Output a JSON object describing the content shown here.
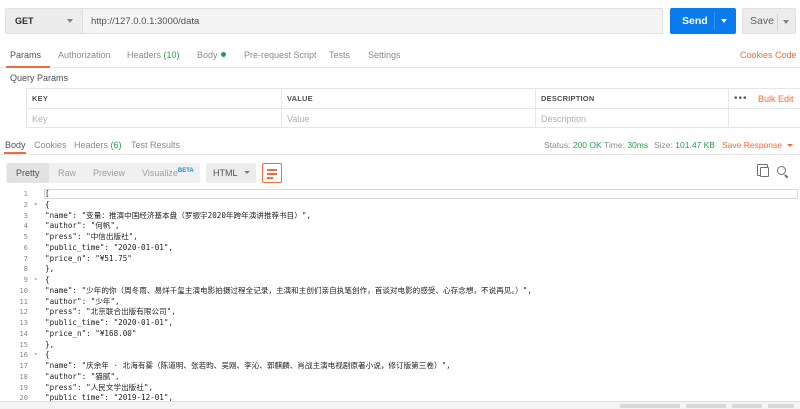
{
  "request": {
    "method": "GET",
    "url": "http://127.0.0.1:3000/data",
    "send_label": "Send",
    "save_label": "Save"
  },
  "request_tabs": [
    {
      "label": "Params",
      "active": true
    },
    {
      "label": "Authorization"
    },
    {
      "label": "Headers",
      "count": "(10)"
    },
    {
      "label": "Body",
      "dot": true
    },
    {
      "label": "Pre-request Script"
    },
    {
      "label": "Tests"
    },
    {
      "label": "Settings"
    }
  ],
  "links": {
    "cookies": "Cookies",
    "code": "Code",
    "bulk_edit": "Bulk Edit",
    "more": "•••"
  },
  "query_params": {
    "title": "Query Params",
    "headers": [
      "KEY",
      "VALUE",
      "DESCRIPTION"
    ],
    "placeholders": [
      "Key",
      "Value",
      "Description"
    ]
  },
  "response_tabs": [
    {
      "label": "Body",
      "active": true
    },
    {
      "label": "Cookies"
    },
    {
      "label": "Headers",
      "count": "(6)"
    },
    {
      "label": "Test Results"
    }
  ],
  "response_status": {
    "status_label": "Status:",
    "status_value": "200 OK",
    "time_label": "Time:",
    "time_value": "30ms",
    "size_label": "Size:",
    "size_value": "101.47 KB",
    "save_response": "Save Response"
  },
  "format_buttons": {
    "pretty": "Pretty",
    "raw": "Raw",
    "preview": "Preview",
    "visualize": "Visualize",
    "beta": "BETA"
  },
  "language": "HTML",
  "code_lines": [
    {
      "n": "1",
      "fold": "",
      "text": "["
    },
    {
      "n": "2",
      "fold": "▾",
      "text": "{"
    },
    {
      "n": "3",
      "fold": "",
      "text": "\"name\": \"变量：推演中国经济基本盘（罗振宇2020年跨年演讲推荐书目）\","
    },
    {
      "n": "4",
      "fold": "",
      "text": "\"author\": \"何帆\","
    },
    {
      "n": "5",
      "fold": "",
      "text": "\"press\": \"中信出版社\","
    },
    {
      "n": "6",
      "fold": "",
      "text": "\"public_time\": \"2020-01-01\","
    },
    {
      "n": "7",
      "fold": "",
      "text": "\"price_n\": \"¥51.75\""
    },
    {
      "n": "8",
      "fold": "",
      "text": "},"
    },
    {
      "n": "9",
      "fold": "▾",
      "text": "{"
    },
    {
      "n": "10",
      "fold": "",
      "text": "\"name\": \"少年的你（周冬雨、易烊千玺主演电影拍摄过程全记录，主演和主创们亲自执笔创作，首谈对电影的感受、心存念想，不说再见。）\","
    },
    {
      "n": "11",
      "fold": "",
      "text": "\"author\": \"少年\","
    },
    {
      "n": "12",
      "fold": "",
      "text": "\"press\": \"北京联合出版有限公司\","
    },
    {
      "n": "13",
      "fold": "",
      "text": "\"public_time\": \"2020-01-01\","
    },
    {
      "n": "14",
      "fold": "",
      "text": "\"price_n\": \"¥168.00\""
    },
    {
      "n": "15",
      "fold": "",
      "text": "},"
    },
    {
      "n": "16",
      "fold": "▾",
      "text": "{"
    },
    {
      "n": "17",
      "fold": "",
      "text": "\"name\": \"庆余年 · 北海有雾（陈道明、张若昀、吴刚、李沁、郭麒麟、肖战主演电视剧原著小说，修订版第三卷）\","
    },
    {
      "n": "18",
      "fold": "",
      "text": "\"author\": \"猫腻\","
    },
    {
      "n": "19",
      "fold": "",
      "text": "\"press\": \"人民文学出版社\","
    },
    {
      "n": "20",
      "fold": "",
      "text": "\"public_time\": \"2019-12-01\","
    }
  ]
}
